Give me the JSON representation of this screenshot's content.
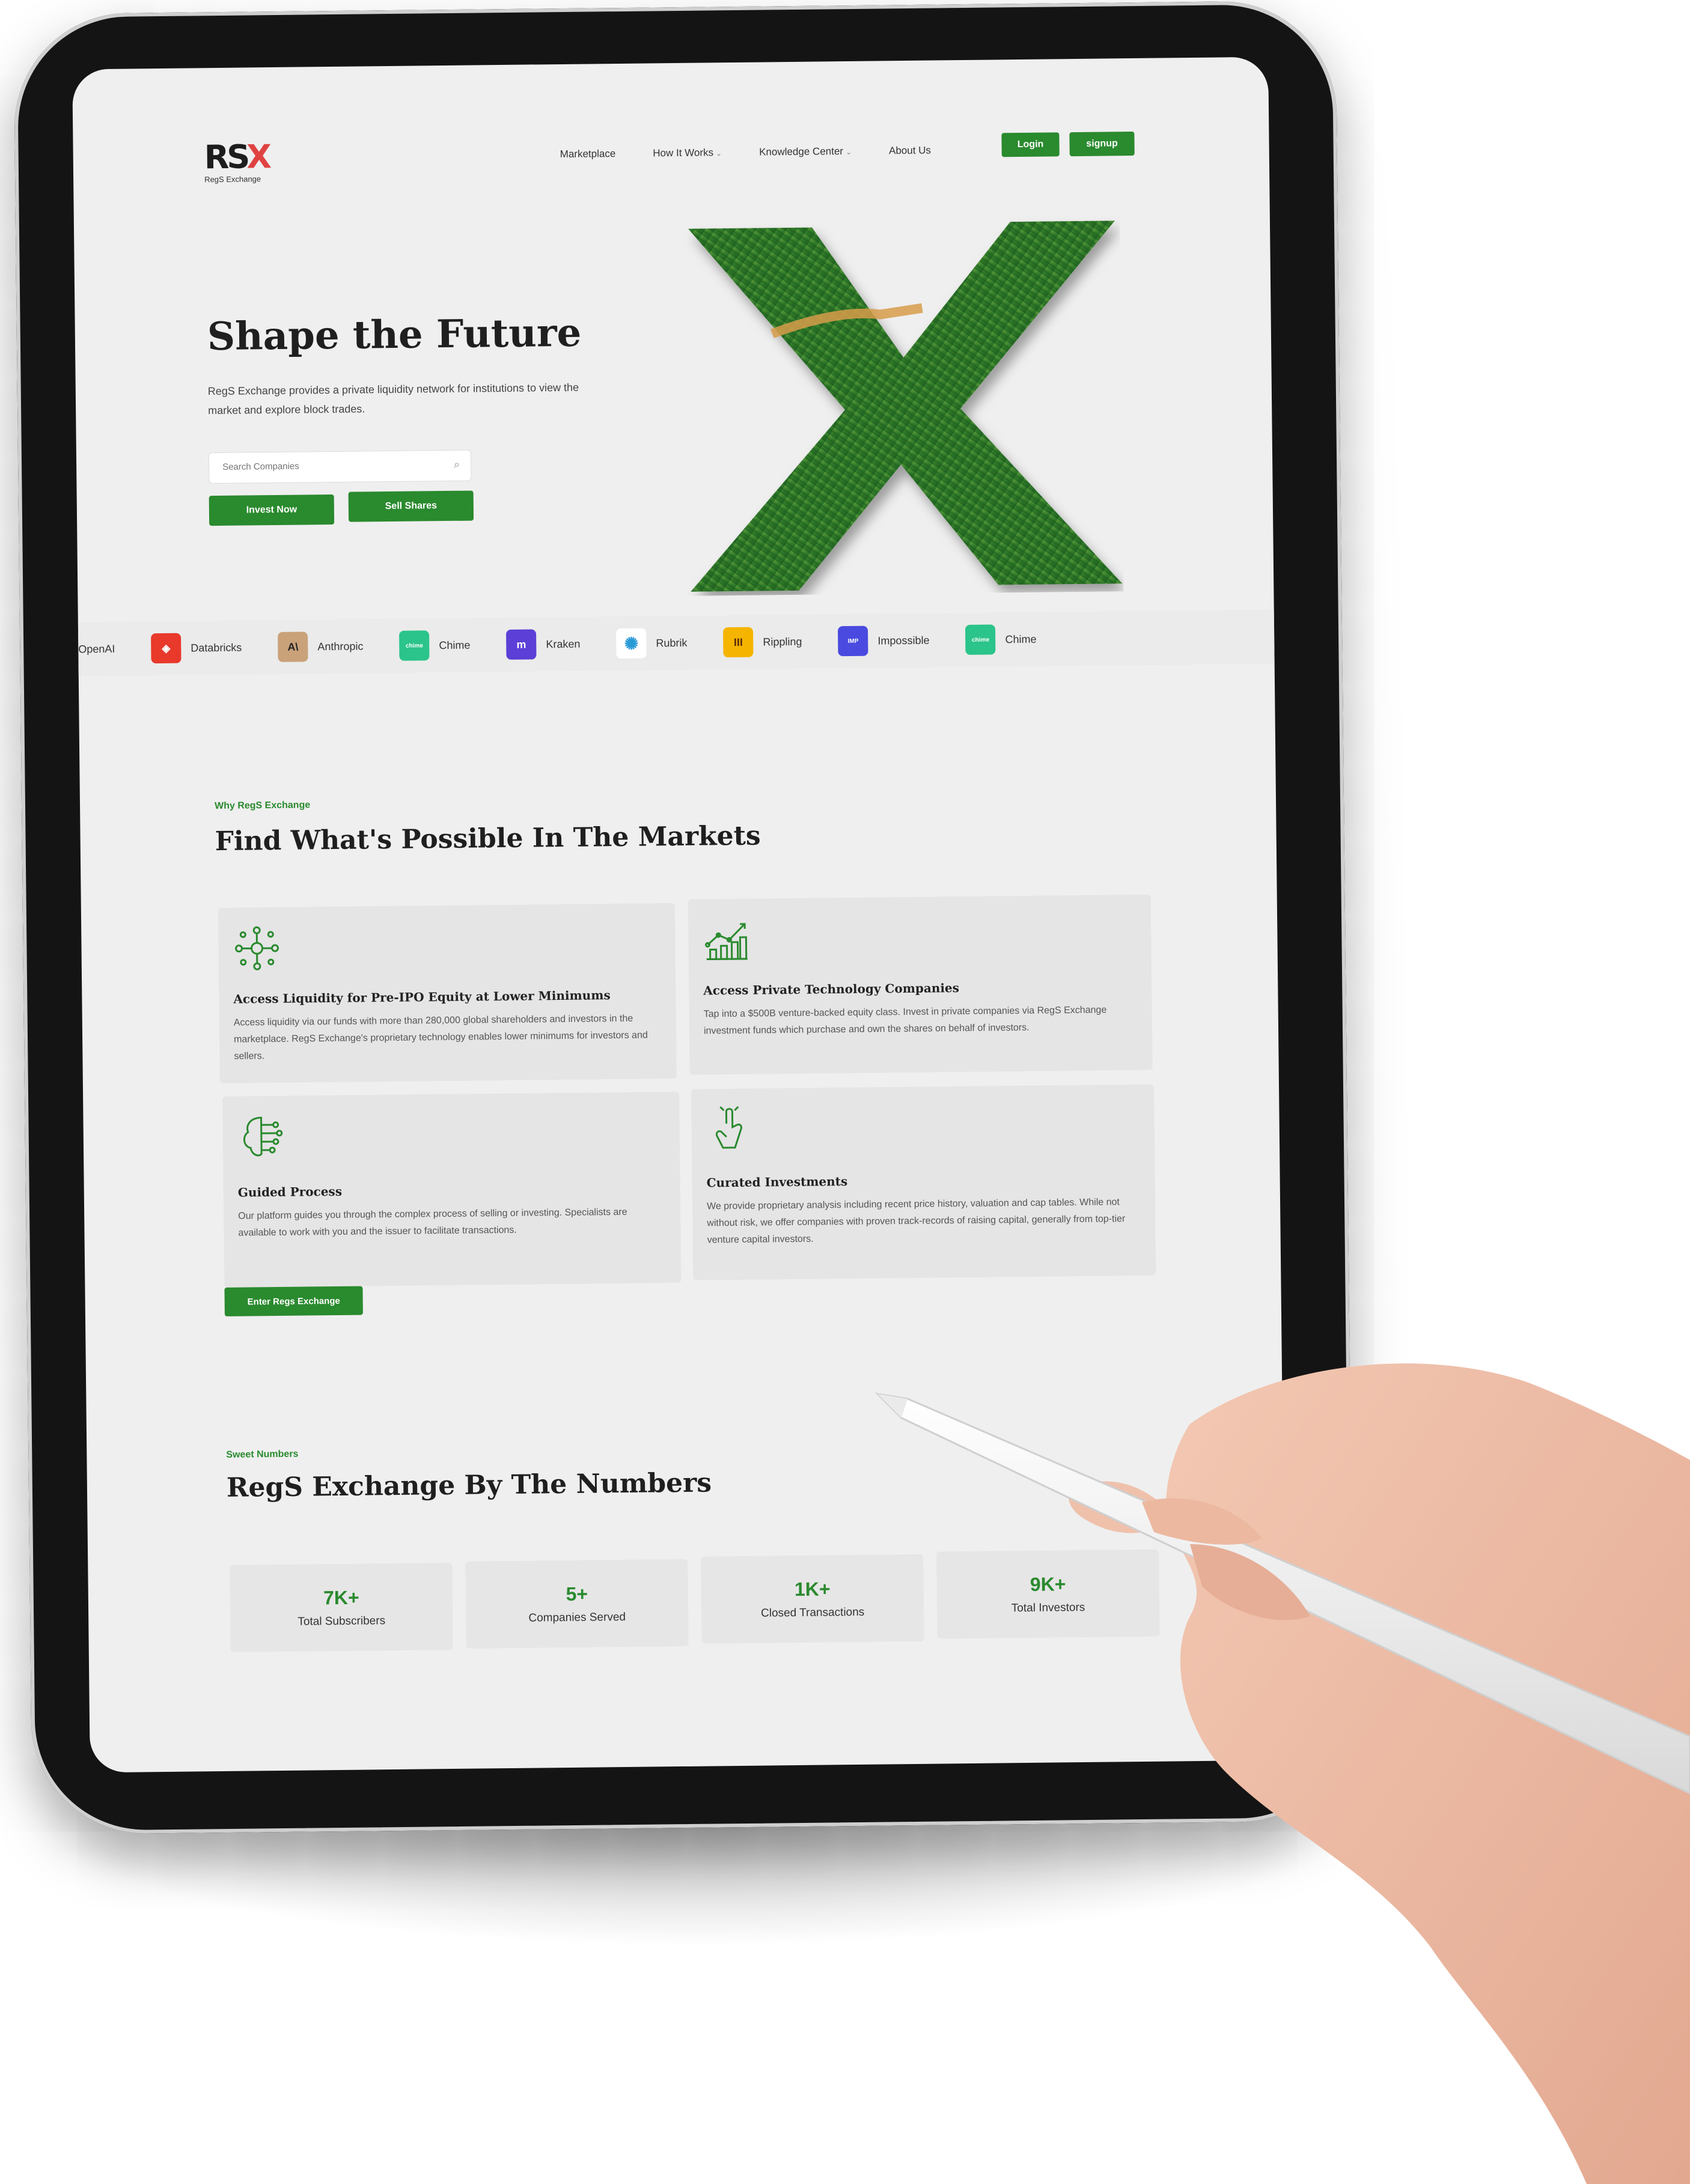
{
  "header": {
    "logo_text": "RSX",
    "logo_sub": "RegS Exchange",
    "nav": [
      {
        "label": "Marketplace",
        "has_dropdown": false
      },
      {
        "label": "How It Works",
        "has_dropdown": true
      },
      {
        "label": "Knowledge Center",
        "has_dropdown": true
      },
      {
        "label": "About Us",
        "has_dropdown": false
      }
    ],
    "login_label": "Login",
    "signup_label": "signup"
  },
  "hero": {
    "title": "Shape the Future",
    "description": "RegS Exchange provides a private liquidity network for institutions to view the market and explore block trades.",
    "search_placeholder": "Search Companies",
    "invest_label": "Invest Now",
    "sell_label": "Sell Shares"
  },
  "brands": [
    {
      "name": "OpenAI",
      "color": "#ffffff",
      "glyph": ""
    },
    {
      "name": "Databricks",
      "color": "#e8392b",
      "glyph": "◈"
    },
    {
      "name": "Anthropic",
      "color": "#c9a27a",
      "glyph": "A\\"
    },
    {
      "name": "Chime",
      "color": "#2bc48a",
      "glyph": "chime"
    },
    {
      "name": "Kraken",
      "color": "#5b3fd6",
      "glyph": "m"
    },
    {
      "name": "Rubrik",
      "color": "#ffffff",
      "glyph": "✺"
    },
    {
      "name": "Rippling",
      "color": "#f5b400",
      "glyph": "III"
    },
    {
      "name": "Impossible",
      "color": "#4a4ae0",
      "glyph": "IMP"
    },
    {
      "name": "Chime",
      "color": "#2bc48a",
      "glyph": "chime"
    }
  ],
  "why": {
    "eyebrow": "Why RegS Exchange",
    "title": "Find What's Possible In The Markets",
    "cards": [
      {
        "icon": "network-icon",
        "title": "Access Liquidity for Pre-IPO Equity at Lower Minimums",
        "text": "Access liquidity via our funds with more than 280,000 global shareholders and investors in the marketplace. RegS Exchange's proprietary technology enables lower minimums for investors and sellers."
      },
      {
        "icon": "growth-chart-icon",
        "title": "Access Private Technology Companies",
        "text": "Tap into a $500B venture-backed equity class. Invest in private companies via RegS Exchange investment funds which purchase and own the shares on behalf of investors."
      },
      {
        "icon": "brain-circuit-icon",
        "title": "Guided Process",
        "text": "Our platform guides you through the complex process of selling or investing. Specialists are available to work with you and the issuer to facilitate transactions."
      },
      {
        "icon": "hand-pointer-icon",
        "title": "Curated Investments",
        "text": "We provide proprietary analysis including recent price history, valuation and cap tables. While not without risk, we offer companies with proven track-records of raising capital, generally from top-tier venture capital investors."
      }
    ],
    "cta_label": "Enter Regs Exchange"
  },
  "numbers": {
    "eyebrow": "Sweet Numbers",
    "title": "RegS Exchange By The Numbers",
    "stats": [
      {
        "value": "7K+",
        "label": "Total Subscribers"
      },
      {
        "value": "5+",
        "label": "Companies Served"
      },
      {
        "value": "1K+",
        "label": "Closed Transactions"
      },
      {
        "value": "9K+",
        "label": "Total Investors"
      }
    ]
  },
  "colors": {
    "accent": "#2a8a2e",
    "logo_x": "#e04242",
    "screen_bg": "#efefef"
  }
}
